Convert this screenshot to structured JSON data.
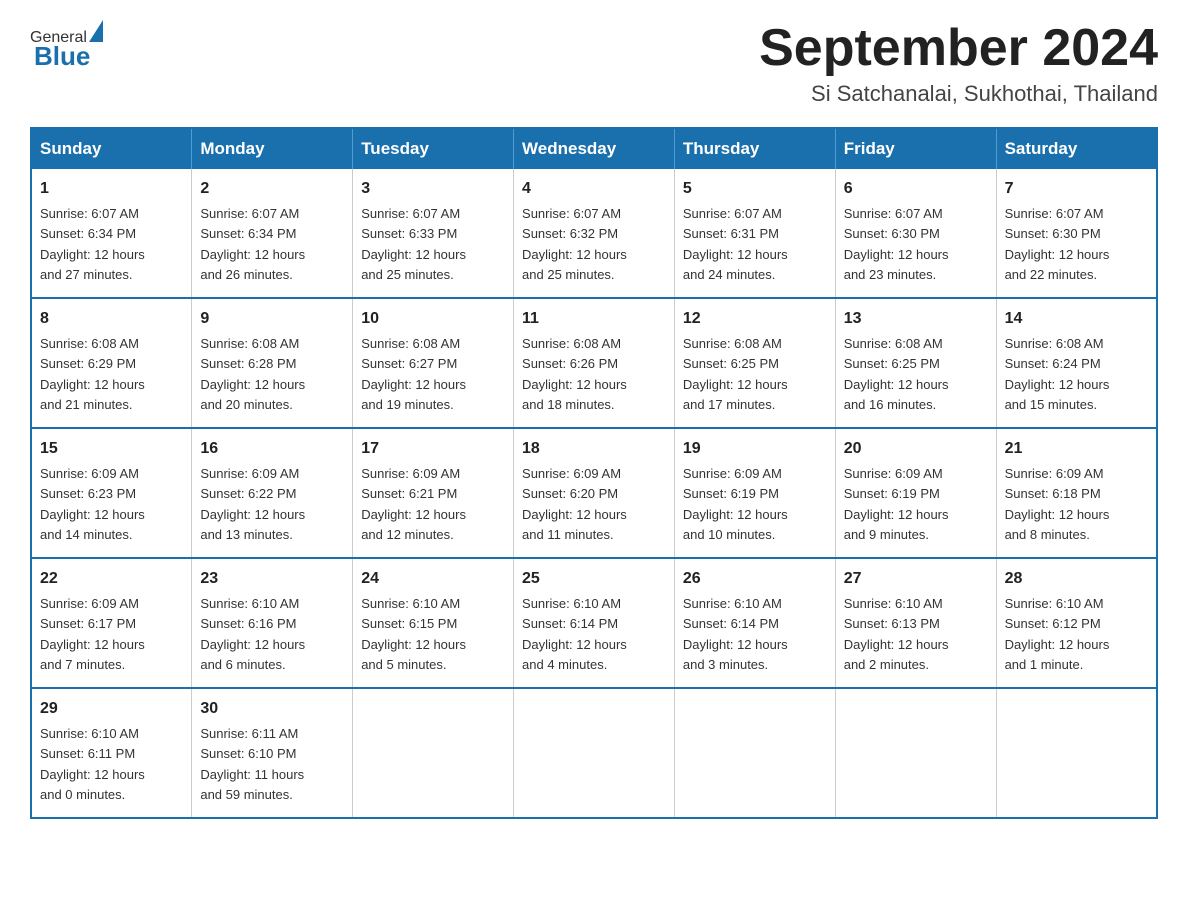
{
  "header": {
    "logo_general": "General",
    "logo_blue": "Blue",
    "month_title": "September 2024",
    "location": "Si Satchanalai, Sukhothai, Thailand"
  },
  "days_of_week": [
    "Sunday",
    "Monday",
    "Tuesday",
    "Wednesday",
    "Thursday",
    "Friday",
    "Saturday"
  ],
  "weeks": [
    [
      {
        "day": "1",
        "sunrise": "6:07 AM",
        "sunset": "6:34 PM",
        "daylight": "12 hours and 27 minutes."
      },
      {
        "day": "2",
        "sunrise": "6:07 AM",
        "sunset": "6:34 PM",
        "daylight": "12 hours and 26 minutes."
      },
      {
        "day": "3",
        "sunrise": "6:07 AM",
        "sunset": "6:33 PM",
        "daylight": "12 hours and 25 minutes."
      },
      {
        "day": "4",
        "sunrise": "6:07 AM",
        "sunset": "6:32 PM",
        "daylight": "12 hours and 25 minutes."
      },
      {
        "day": "5",
        "sunrise": "6:07 AM",
        "sunset": "6:31 PM",
        "daylight": "12 hours and 24 minutes."
      },
      {
        "day": "6",
        "sunrise": "6:07 AM",
        "sunset": "6:30 PM",
        "daylight": "12 hours and 23 minutes."
      },
      {
        "day": "7",
        "sunrise": "6:07 AM",
        "sunset": "6:30 PM",
        "daylight": "12 hours and 22 minutes."
      }
    ],
    [
      {
        "day": "8",
        "sunrise": "6:08 AM",
        "sunset": "6:29 PM",
        "daylight": "12 hours and 21 minutes."
      },
      {
        "day": "9",
        "sunrise": "6:08 AM",
        "sunset": "6:28 PM",
        "daylight": "12 hours and 20 minutes."
      },
      {
        "day": "10",
        "sunrise": "6:08 AM",
        "sunset": "6:27 PM",
        "daylight": "12 hours and 19 minutes."
      },
      {
        "day": "11",
        "sunrise": "6:08 AM",
        "sunset": "6:26 PM",
        "daylight": "12 hours and 18 minutes."
      },
      {
        "day": "12",
        "sunrise": "6:08 AM",
        "sunset": "6:25 PM",
        "daylight": "12 hours and 17 minutes."
      },
      {
        "day": "13",
        "sunrise": "6:08 AM",
        "sunset": "6:25 PM",
        "daylight": "12 hours and 16 minutes."
      },
      {
        "day": "14",
        "sunrise": "6:08 AM",
        "sunset": "6:24 PM",
        "daylight": "12 hours and 15 minutes."
      }
    ],
    [
      {
        "day": "15",
        "sunrise": "6:09 AM",
        "sunset": "6:23 PM",
        "daylight": "12 hours and 14 minutes."
      },
      {
        "day": "16",
        "sunrise": "6:09 AM",
        "sunset": "6:22 PM",
        "daylight": "12 hours and 13 minutes."
      },
      {
        "day": "17",
        "sunrise": "6:09 AM",
        "sunset": "6:21 PM",
        "daylight": "12 hours and 12 minutes."
      },
      {
        "day": "18",
        "sunrise": "6:09 AM",
        "sunset": "6:20 PM",
        "daylight": "12 hours and 11 minutes."
      },
      {
        "day": "19",
        "sunrise": "6:09 AM",
        "sunset": "6:19 PM",
        "daylight": "12 hours and 10 minutes."
      },
      {
        "day": "20",
        "sunrise": "6:09 AM",
        "sunset": "6:19 PM",
        "daylight": "12 hours and 9 minutes."
      },
      {
        "day": "21",
        "sunrise": "6:09 AM",
        "sunset": "6:18 PM",
        "daylight": "12 hours and 8 minutes."
      }
    ],
    [
      {
        "day": "22",
        "sunrise": "6:09 AM",
        "sunset": "6:17 PM",
        "daylight": "12 hours and 7 minutes."
      },
      {
        "day": "23",
        "sunrise": "6:10 AM",
        "sunset": "6:16 PM",
        "daylight": "12 hours and 6 minutes."
      },
      {
        "day": "24",
        "sunrise": "6:10 AM",
        "sunset": "6:15 PM",
        "daylight": "12 hours and 5 minutes."
      },
      {
        "day": "25",
        "sunrise": "6:10 AM",
        "sunset": "6:14 PM",
        "daylight": "12 hours and 4 minutes."
      },
      {
        "day": "26",
        "sunrise": "6:10 AM",
        "sunset": "6:14 PM",
        "daylight": "12 hours and 3 minutes."
      },
      {
        "day": "27",
        "sunrise": "6:10 AM",
        "sunset": "6:13 PM",
        "daylight": "12 hours and 2 minutes."
      },
      {
        "day": "28",
        "sunrise": "6:10 AM",
        "sunset": "6:12 PM",
        "daylight": "12 hours and 1 minute."
      }
    ],
    [
      {
        "day": "29",
        "sunrise": "6:10 AM",
        "sunset": "6:11 PM",
        "daylight": "12 hours and 0 minutes."
      },
      {
        "day": "30",
        "sunrise": "6:11 AM",
        "sunset": "6:10 PM",
        "daylight": "11 hours and 59 minutes."
      },
      null,
      null,
      null,
      null,
      null
    ]
  ],
  "labels": {
    "sunrise": "Sunrise:",
    "sunset": "Sunset:",
    "daylight": "Daylight:"
  }
}
